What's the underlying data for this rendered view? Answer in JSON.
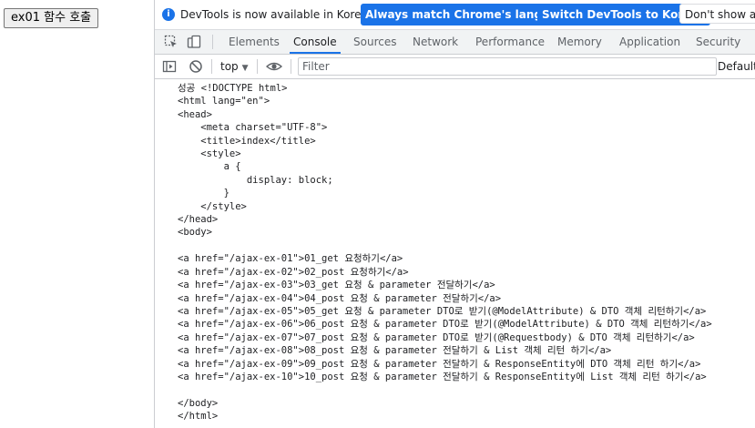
{
  "page": {
    "button_label": "ex01 함수 호출"
  },
  "infobar": {
    "icon_glyph": "i",
    "message": "DevTools is now available in Korean!",
    "btn_match": "Always match Chrome's language",
    "btn_switch": "Switch DevTools to Korean",
    "btn_dont_show": "Don't show again"
  },
  "tabs": [
    "Elements",
    "Console",
    "Sources",
    "Network",
    "Performance",
    "Memory",
    "Application",
    "Security"
  ],
  "active_tab": "Console",
  "toolbar": {
    "context": "top",
    "context_arrow": "▼",
    "filter_placeholder": "Filter",
    "levels": "Default levels"
  },
  "colors": {
    "accent": "#1a73e8",
    "panel_bg": "#f1f3f4",
    "border": "#cbcdd1"
  },
  "console_output": [
    "성공 <!DOCTYPE html>",
    "<html lang=\"en\">",
    "<head>",
    "    <meta charset=\"UTF-8\">",
    "    <title>index</title>",
    "    <style>",
    "        a {",
    "            display: block;",
    "        }",
    "    </style>",
    "</head>",
    "<body>",
    "",
    "<a href=\"/ajax-ex-01\">01_get 요청하기</a>",
    "<a href=\"/ajax-ex-02\">02_post 요청하기</a>",
    "<a href=\"/ajax-ex-03\">03_get 요청 & parameter 전달하기</a>",
    "<a href=\"/ajax-ex-04\">04_post 요청 & parameter 전달하기</a>",
    "<a href=\"/ajax-ex-05\">05_get 요청 & parameter DTO로 받기(@ModelAttribute) & DTO 객체 리턴하기</a>",
    "<a href=\"/ajax-ex-06\">06_post 요청 & parameter DTO로 받기(@ModelAttribute) & DTO 객체 리턴하기</a>",
    "<a href=\"/ajax-ex-07\">07_post 요청 & parameter DTO로 받기(@Requestbody) & DTO 객체 리턴하기</a>",
    "<a href=\"/ajax-ex-08\">08_post 요청 & parameter 전달하기 & List 객체 리턴 하기</a>",
    "<a href=\"/ajax-ex-09\">09_post 요청 & parameter 전달하기 & ResponseEntity에 DTO 객체 리턴 하기</a>",
    "<a href=\"/ajax-ex-10\">10_post 요청 & parameter 전달하기 & ResponseEntity에 List 객체 리턴 하기</a>",
    "",
    "</body>",
    "</html>"
  ]
}
